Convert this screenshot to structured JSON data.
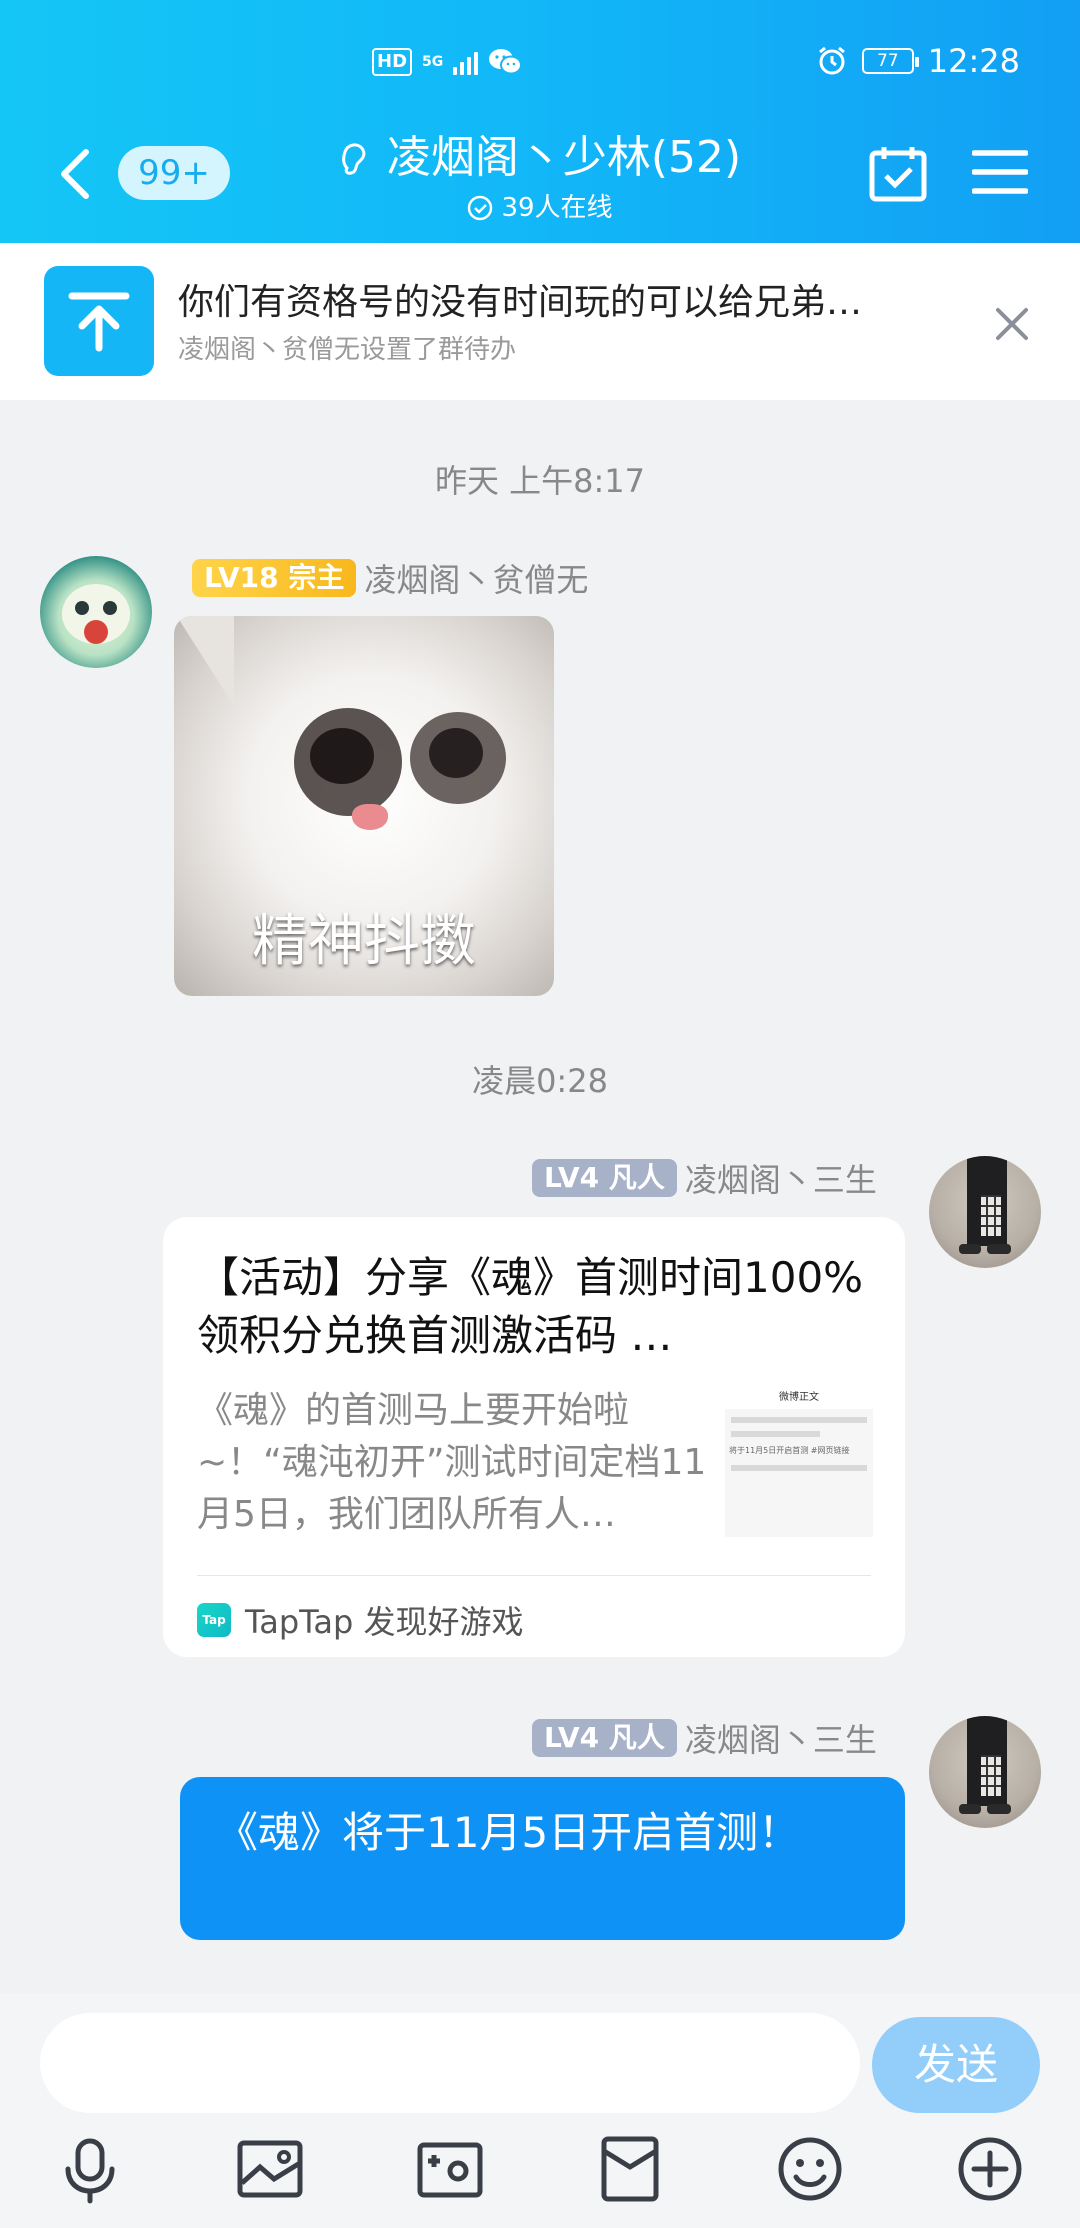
{
  "status_bar": {
    "hd": "HD",
    "network": "5G",
    "battery": "77",
    "time": "12:28"
  },
  "header": {
    "unread_badge": "99+",
    "group_name": "凌烟阁丶少林(52)",
    "online_text": "39人在线"
  },
  "pinned_notice": {
    "text": "你们有资格号的没有时间玩的可以给兄弟…",
    "sub": "凌烟阁丶贫僧无设置了群待办"
  },
  "messages": {
    "time1": "昨天 上午8:17",
    "sender1": {
      "level": "LV18",
      "title": "宗主",
      "name": "凌烟阁丶贫僧无"
    },
    "sticker_caption": "精神抖擞",
    "time2": "凌晨0:28",
    "sender2": {
      "level": "LV4",
      "title": "凡人",
      "name": "凌烟阁丶三生"
    },
    "share_card": {
      "title": "【活动】分享《魂》首测时间100%领积分兑换首测激活码 …",
      "desc": "《魂》的首测马上要开始啦~！“魂沌初开”测试时间定档11月5日，我们团队所有人…",
      "thumb_title": "微博正文",
      "thumb_text": "将于11月5日开启首测 #网页链接",
      "source": "TapTap 发现好游戏",
      "source_logo": "Tap"
    },
    "sender3": {
      "level": "LV4",
      "title": "凡人",
      "name": "凌烟阁丶三生"
    },
    "text_bubble": "《魂》将于11月5日开启首测！"
  },
  "input_bar": {
    "send_label": "发送",
    "tools": [
      "mic-icon",
      "image-icon",
      "camera-icon",
      "red-packet-icon",
      "emoji-icon",
      "plus-icon"
    ]
  },
  "colors": {
    "header_gradient_start": "#14c6f6",
    "header_gradient_end": "#129ff4",
    "bubble_blue": "#0f92f6",
    "send_button": "#93cdf9",
    "level_gold": "#f8b81c",
    "level_gray": "#a7b1c8"
  }
}
